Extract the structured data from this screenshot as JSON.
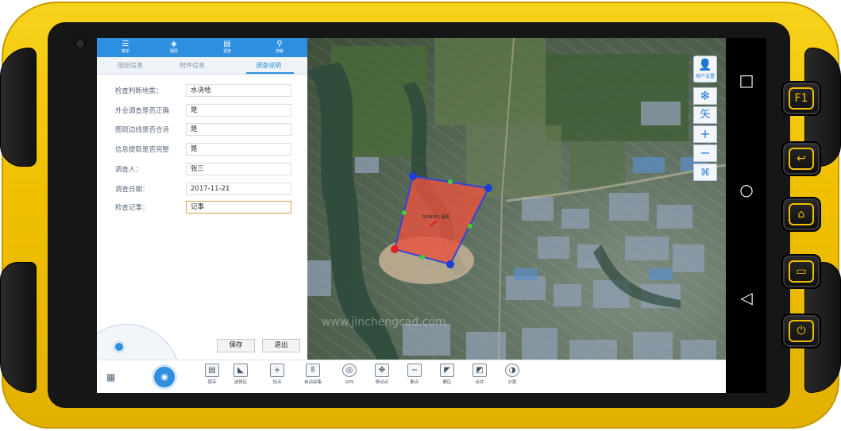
{
  "topbar": {
    "items": [
      {
        "icon": "menu-icon",
        "label": "菜单"
      },
      {
        "icon": "layers-icon",
        "label": "图层"
      },
      {
        "icon": "survey-icon",
        "label": "调查"
      },
      {
        "icon": "search-icon",
        "label": "搜索"
      }
    ]
  },
  "tabs": [
    {
      "label": "图斑信息",
      "active": false
    },
    {
      "label": "附件信息",
      "active": false
    },
    {
      "label": "调查说明",
      "active": true
    }
  ],
  "form": {
    "rows": [
      {
        "label": "检查判断地类：",
        "value": "水浇地"
      },
      {
        "label": "外业调查是否正确",
        "value": "是"
      },
      {
        "label": "图斑边线是否合适",
        "value": "是"
      },
      {
        "label": "信息提取是否完整",
        "value": "是"
      },
      {
        "label": "调查人：",
        "value": "张三"
      },
      {
        "label": "调查日期：",
        "value": "2017-11-21"
      },
      {
        "label": "检查记事：",
        "value": "记事"
      }
    ],
    "save_label": "保存",
    "exit_label": "退出"
  },
  "map": {
    "polygon_fill": "#e9523f",
    "polygon_stroke": "#2f46d6",
    "feature_label": "5004551 图斑",
    "watermark": "www.jinchengcad.com",
    "buttons": {
      "user_label": "用户设置",
      "snowflake": "❄",
      "arrow": "矢",
      "zoom_in": "+",
      "zoom_out": "−",
      "fullscreen": "⌘"
    }
  },
  "toolbar": {
    "tools": [
      {
        "icon": "save-icon",
        "label": "保存"
      },
      {
        "icon": "select-area-icon",
        "label": "选择区"
      },
      {
        "icon": "add-point-icon",
        "label": "加点"
      },
      {
        "icon": "auto-collect-icon",
        "label": "自动采集"
      },
      {
        "icon": "gps-icon",
        "label": "GPS"
      },
      {
        "icon": "move-point-icon",
        "label": "移动点"
      },
      {
        "icon": "delete-point-icon",
        "label": "删点"
      },
      {
        "icon": "delete-area-icon",
        "label": "删区"
      },
      {
        "icon": "merge-icon",
        "label": "合并"
      },
      {
        "icon": "split-icon",
        "label": "分割"
      }
    ]
  },
  "device": {
    "keys": [
      "F1",
      "↩",
      "⌂",
      "▭",
      "⏻"
    ],
    "nav": [
      "□",
      "○",
      "◁"
    ]
  },
  "colors": {
    "shell": "#f0c000",
    "accent": "#2e8fe0"
  }
}
